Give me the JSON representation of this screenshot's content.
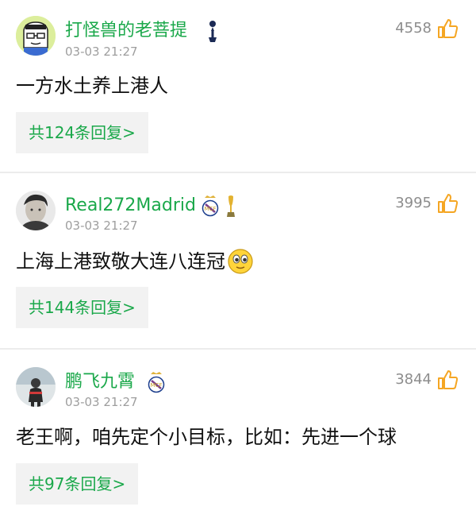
{
  "comments": [
    {
      "username": "打怪兽的老菩提",
      "timestamp": "03-03 21:27",
      "likes": "4558",
      "content": "一方水土养上港人",
      "replies_label": "共124条回复>",
      "badges": [
        "tottenham-badge-icon"
      ]
    },
    {
      "username": "Real272Madrid",
      "timestamp": "03-03 21:27",
      "likes": "3995",
      "content": "上海上港致敬大连八连冠",
      "content_emoji": "smiley-emoji-icon",
      "replies_label": "共144条回复>",
      "badges": [
        "real-madrid-badge-icon",
        "trophy-badge-icon"
      ]
    },
    {
      "username": "鹏飞九霄",
      "timestamp": "03-03 21:27",
      "likes": "3844",
      "content": "老王啊，咱先定个小目标，比如：先进一个球",
      "replies_label": "共97条回复>",
      "badges": [
        "real-madrid-badge-icon"
      ]
    }
  ],
  "colors": {
    "username": "#1aa84a",
    "reply_text": "#1aa84a",
    "reply_bg": "#f2f2f2",
    "like_icon": "#f5a623",
    "timestamp": "#9e9e9e"
  }
}
